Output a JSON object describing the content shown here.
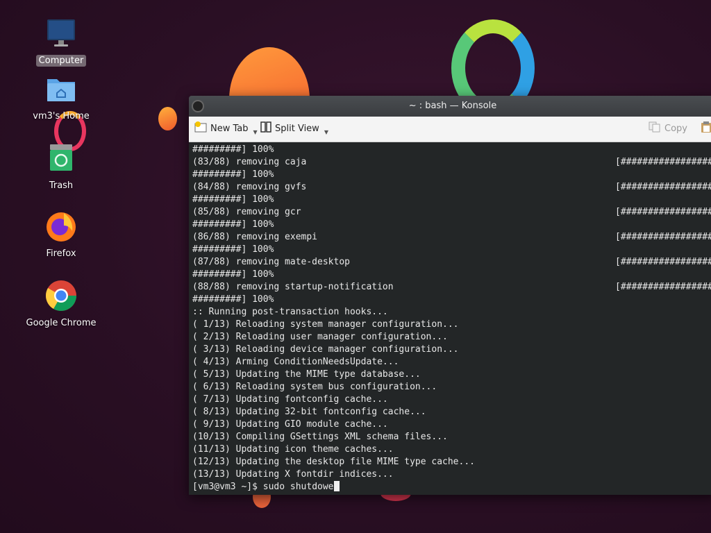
{
  "desktop": {
    "icons": [
      {
        "label": "Computer",
        "icon": "monitor-icon",
        "selected": true
      },
      {
        "label": "vm3's Home",
        "icon": "home-folder-icon"
      },
      {
        "label": "Trash",
        "icon": "trash-icon"
      },
      {
        "label": "Firefox",
        "icon": "firefox-icon"
      },
      {
        "label": "Google Chrome",
        "icon": "chrome-icon"
      }
    ]
  },
  "konsole": {
    "title": "~ : bash — Konsole",
    "toolbar": {
      "new_tab": "New Tab",
      "split_view": "Split View",
      "copy": "Copy"
    },
    "progress_bar_text": "[##################",
    "lines": [
      {
        "text": "#########] 100%"
      },
      {
        "text": "(83/88) removing caja",
        "progress": true
      },
      {
        "text": "#########] 100%"
      },
      {
        "text": "(84/88) removing gvfs",
        "progress": true
      },
      {
        "text": "#########] 100%"
      },
      {
        "text": "(85/88) removing gcr",
        "progress": true
      },
      {
        "text": "#########] 100%"
      },
      {
        "text": "(86/88) removing exempi",
        "progress": true
      },
      {
        "text": "#########] 100%"
      },
      {
        "text": "(87/88) removing mate-desktop",
        "progress": true
      },
      {
        "text": "#########] 100%"
      },
      {
        "text": "(88/88) removing startup-notification",
        "progress": true
      },
      {
        "text": "#########] 100%"
      },
      {
        "text": ":: Running post-transaction hooks..."
      },
      {
        "text": "( 1/13) Reloading system manager configuration..."
      },
      {
        "text": "( 2/13) Reloading user manager configuration..."
      },
      {
        "text": "( 3/13) Reloading device manager configuration..."
      },
      {
        "text": "( 4/13) Arming ConditionNeedsUpdate..."
      },
      {
        "text": "( 5/13) Updating the MIME type database..."
      },
      {
        "text": "( 6/13) Reloading system bus configuration..."
      },
      {
        "text": "( 7/13) Updating fontconfig cache..."
      },
      {
        "text": "( 8/13) Updating 32-bit fontconfig cache..."
      },
      {
        "text": "( 9/13) Updating GIO module cache..."
      },
      {
        "text": "(10/13) Compiling GSettings XML schema files..."
      },
      {
        "text": "(11/13) Updating icon theme caches..."
      },
      {
        "text": "(12/13) Updating the desktop file MIME type cache..."
      },
      {
        "text": "(13/13) Updating X fontdir indices..."
      }
    ],
    "prompt": "[vm3@vm3 ~]$ ",
    "input": "sudo shutdowe"
  }
}
